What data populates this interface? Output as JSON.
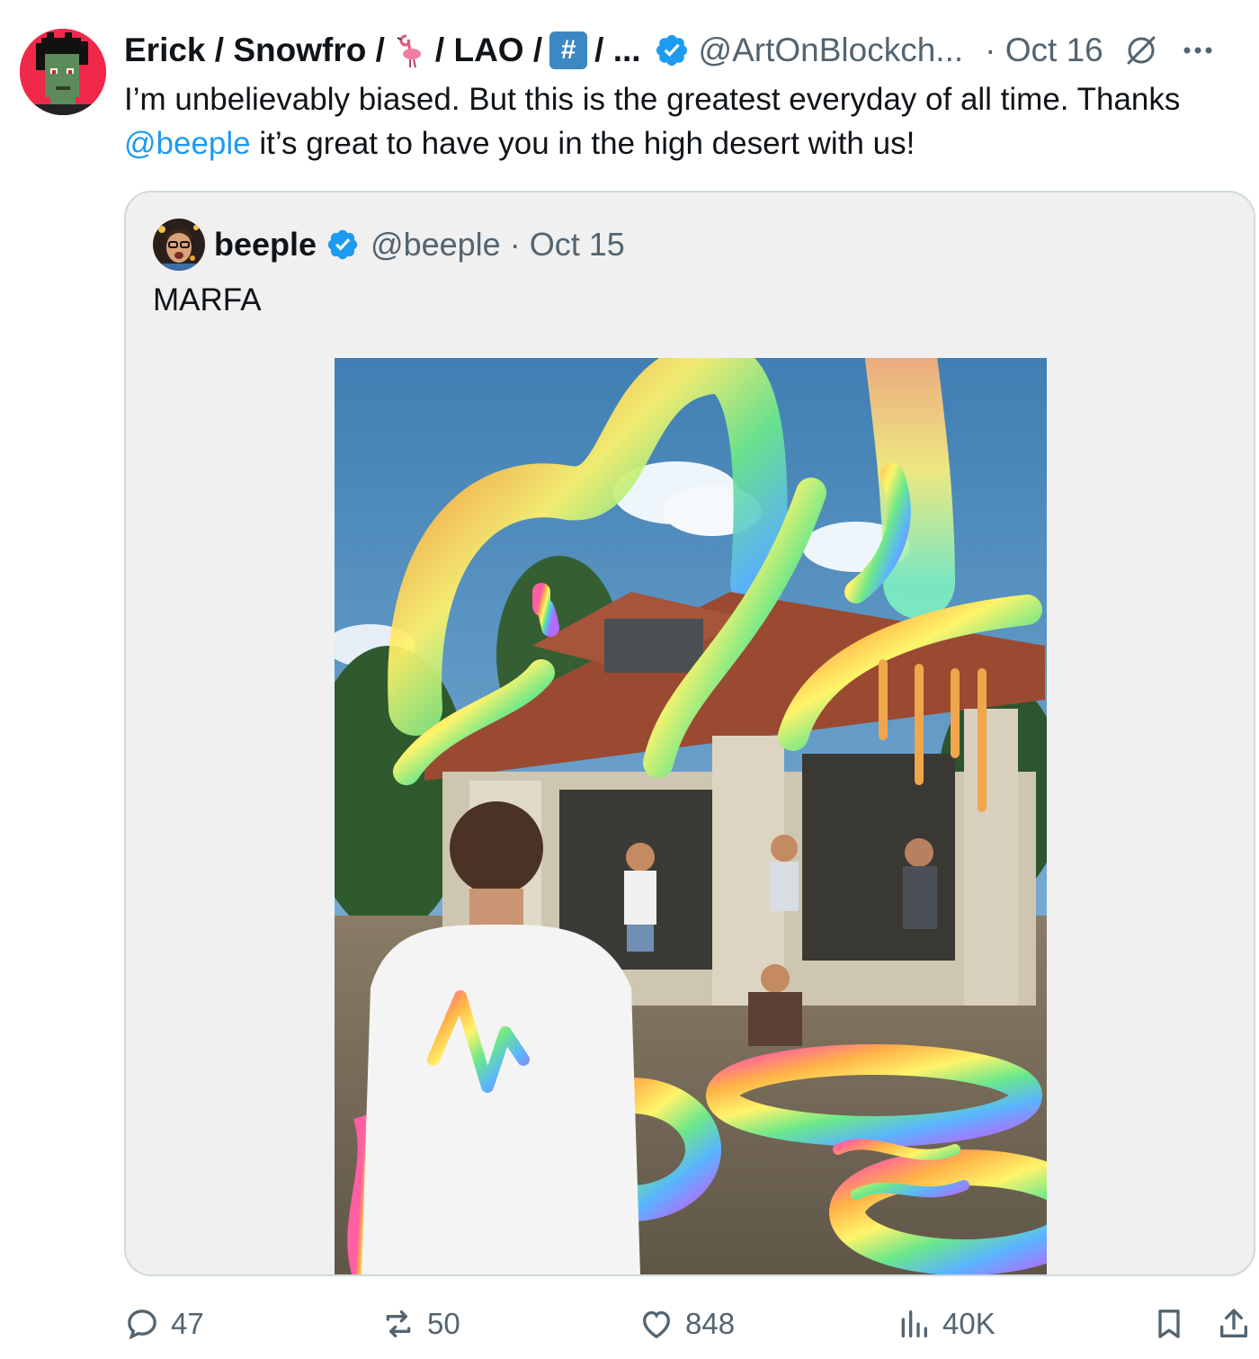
{
  "tweet": {
    "author": {
      "name_parts": [
        "Erick / Snowfro /",
        "/ LAO /",
        "/ ..."
      ],
      "hashtag_symbol": "#",
      "handle": "@ArtOnBlockch...",
      "date": "· Oct 16",
      "avatar_icon": "cryptopunk-avatar",
      "emoji_icon": "flamingo-emoji"
    },
    "text_before": "I’m unbelievably biased. But this is the greatest everyday of all time. Thanks ",
    "mention": "@beeple",
    "text_after": " it’s great to have you in the high desert with us!",
    "quote": {
      "name": "beeple",
      "handle": "@beeple",
      "date": "· Oct 15",
      "text": "MARFA",
      "image_icon": "rainbow-worms-artwork"
    },
    "actions": {
      "replies": "47",
      "reposts": "50",
      "likes": "848",
      "views": "40K"
    }
  },
  "colors": {
    "accent": "#1d9bf0",
    "secondary_text": "#536471",
    "avatar_bg": "#f0284a"
  }
}
